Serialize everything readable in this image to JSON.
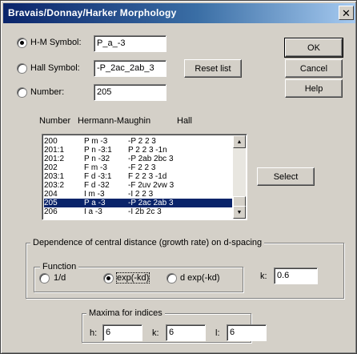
{
  "window": {
    "title": "Bravais/Donnay/Harker Morphology",
    "close_glyph": "✕"
  },
  "symbols": {
    "hm": {
      "label": "H-M Symbol:",
      "value": "P_a_-3",
      "selected": true
    },
    "hall": {
      "label": "Hall Symbol:",
      "value": "-P_2ac_2ab_3",
      "selected": false
    },
    "number": {
      "label": "Number:",
      "value": "205",
      "selected": false
    }
  },
  "buttons": {
    "ok": "OK",
    "cancel": "Cancel",
    "help": "Help",
    "reset": "Reset list",
    "select": "Select"
  },
  "list": {
    "headers": {
      "number": "Number",
      "hm": "Hermann-Maughin",
      "hall": "Hall"
    },
    "rows": [
      {
        "number": "200",
        "hm": "P m -3",
        "hall": "-P 2 2 3"
      },
      {
        "number": "201:1",
        "hm": "P n -3:1",
        "hall": "P 2 2 3 -1n"
      },
      {
        "number": "201:2",
        "hm": "P n -32",
        "hall": "-P 2ab 2bc 3"
      },
      {
        "number": "202",
        "hm": "F m -3",
        "hall": "-F 2 2 3"
      },
      {
        "number": "203:1",
        "hm": "F d -3:1",
        "hall": "F 2 2 3 -1d"
      },
      {
        "number": "203:2",
        "hm": "F d -32",
        "hall": "-F 2uv 2vw 3"
      },
      {
        "number": "204",
        "hm": "I m -3",
        "hall": "-I 2 2 3"
      },
      {
        "number": "205",
        "hm": "P a -3",
        "hall": "-P 2ac 2ab 3",
        "selected": true
      },
      {
        "number": "206",
        "hm": "I a -3",
        "hall": "-I 2b 2c 3"
      }
    ]
  },
  "dependence": {
    "title": "Dependence of central distance (growth rate) on d-spacing",
    "function": {
      "title": "Function",
      "options": [
        {
          "label": "1/d",
          "selected": false
        },
        {
          "label": "exp(-kd)",
          "selected": true
        },
        {
          "label": "d exp(-kd)",
          "selected": false
        }
      ]
    },
    "k_label": "k:",
    "k_value": "0.6"
  },
  "maxima": {
    "title": "Maxima for indices",
    "h_label": "h:",
    "h_value": "6",
    "k_label": "k:",
    "k_value": "6",
    "l_label": "l:",
    "l_value": "6"
  },
  "icons": {
    "scroll_up": "▲",
    "scroll_down": "▼"
  },
  "colors": {
    "title_bar": "#0a246a",
    "selection": "#0a246a",
    "face": "#d4d0c8"
  }
}
